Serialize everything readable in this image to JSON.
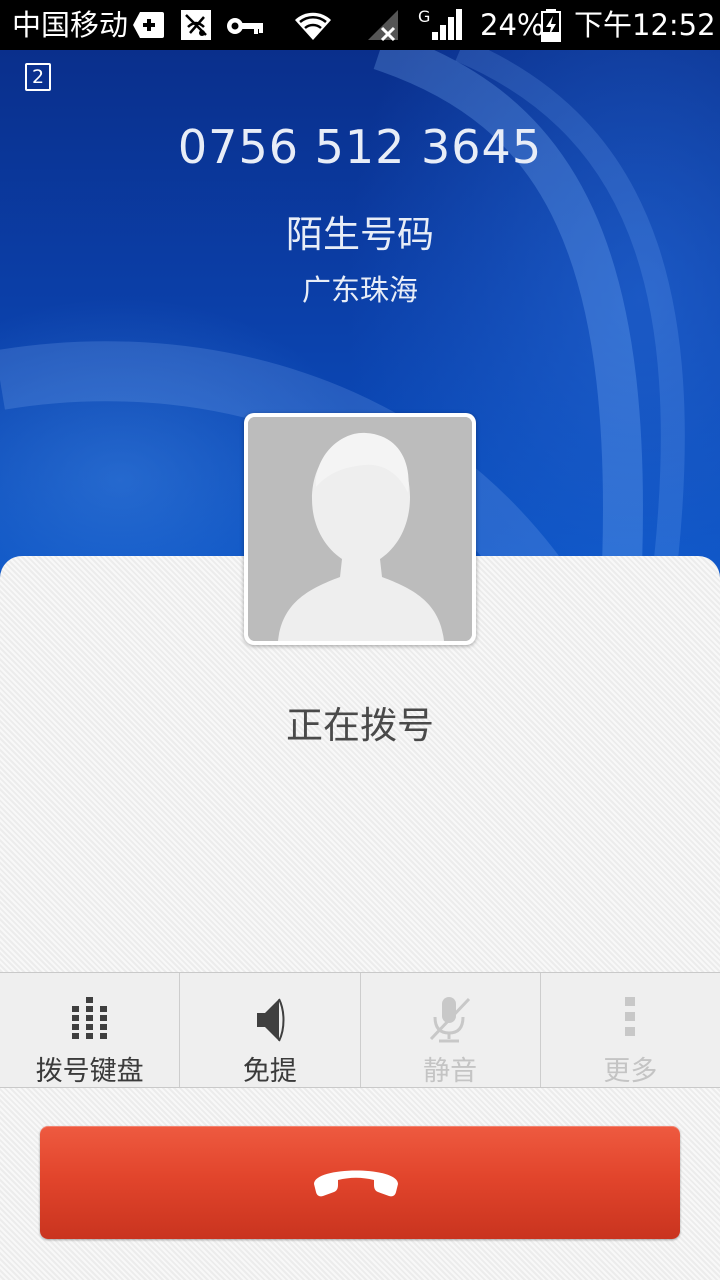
{
  "status_bar": {
    "carrier": "中国移动",
    "network_type": "G",
    "battery_percent": "24%",
    "time": "下午12:52",
    "icons": [
      "plus-notification-icon",
      "app-notification-icon",
      "key-icon",
      "wifi-icon",
      "no-signal-sim1-icon",
      "signal-icon",
      "battery-charging-icon"
    ]
  },
  "call": {
    "sim_slot": "2",
    "phone_number": "0756 512 3645",
    "caller_label": "陌生号码",
    "location": "广东珠海",
    "status": "正在拨号"
  },
  "actions": [
    {
      "label": "拨号键盘",
      "icon": "dialpad-icon",
      "enabled": true
    },
    {
      "label": "免提",
      "icon": "speaker-icon",
      "enabled": true
    },
    {
      "label": "静音",
      "icon": "mute-mic-icon",
      "enabled": false
    },
    {
      "label": "更多",
      "icon": "more-icon",
      "enabled": false
    }
  ],
  "end_call": {
    "icon": "end-call-icon",
    "color": "#e2452c"
  }
}
